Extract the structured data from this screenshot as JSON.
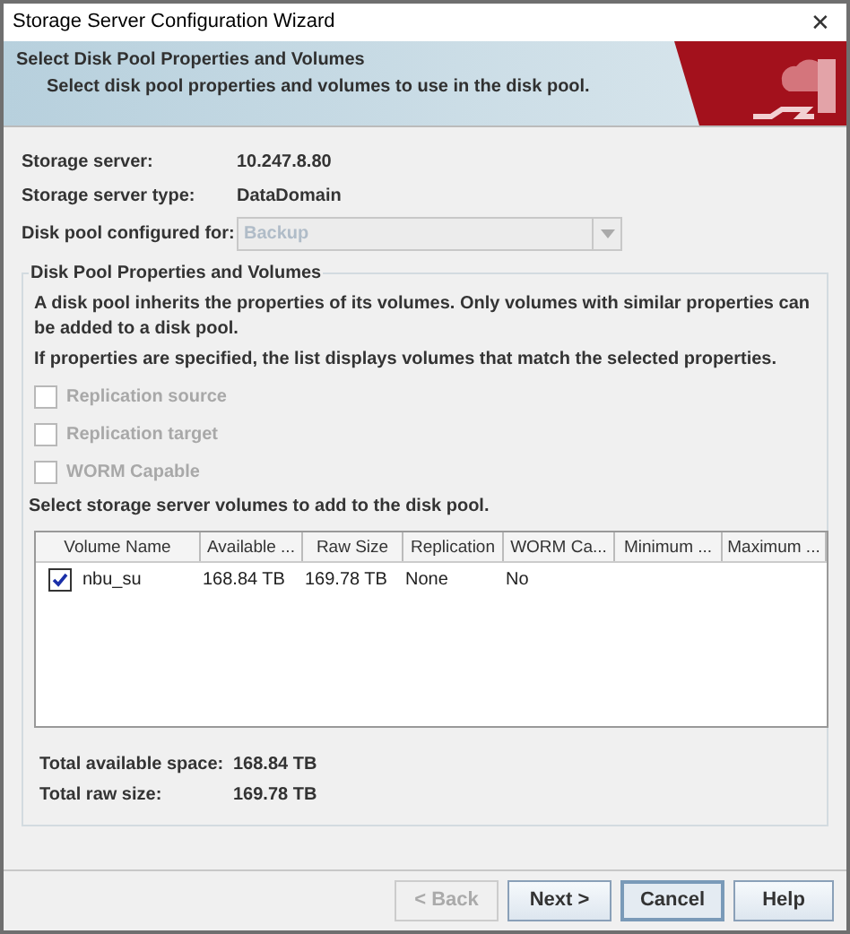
{
  "window": {
    "title": "Storage Server Configuration Wizard",
    "close": "✕"
  },
  "header": {
    "title": "Select Disk Pool Properties and Volumes",
    "subtitle": "Select disk pool properties and volumes to use in the disk pool."
  },
  "info": [
    {
      "label": "Storage server:",
      "value": "10.247.8.80"
    },
    {
      "label": "Storage server type:",
      "value": "DataDomain"
    }
  ],
  "pool": {
    "label": "Disk pool configured for:",
    "value": "Backup",
    "disabled": true
  },
  "group": {
    "title": "Disk Pool Properties and Volumes",
    "paragraphs": [
      "A disk pool inherits the properties of its volumes. Only volumes with similar properties can be added to a disk pool.",
      "If properties are specified, the list displays volumes that match the selected properties."
    ],
    "options": [
      {
        "label": "Replication source",
        "checked": false,
        "disabled": true
      },
      {
        "label": "Replication target",
        "checked": false,
        "disabled": true
      },
      {
        "label": "WORM Capable",
        "checked": false,
        "disabled": true
      }
    ],
    "table_caption": "Select storage server volumes to add to the disk pool.",
    "table": {
      "columns": [
        "Volume Name",
        "Available ...",
        "Raw Size",
        "Replication",
        "WORM Ca...",
        "Minimum ...",
        "Maximum ..."
      ],
      "rows": [
        {
          "checked": true,
          "cells": [
            "nbu_su",
            "168.84 TB",
            "169.78 TB",
            "None",
            "No"
          ]
        }
      ]
    },
    "totals": [
      {
        "label": "Total available space:",
        "value": "168.84 TB"
      },
      {
        "label": "Total raw size:",
        "value": "169.78 TB"
      }
    ]
  },
  "buttons": [
    {
      "label": "< Back",
      "disabled": true,
      "focused": false
    },
    {
      "label": "Next >",
      "disabled": false,
      "focused": false
    },
    {
      "label": "Cancel",
      "disabled": false,
      "focused": true
    },
    {
      "label": "Help",
      "disabled": false,
      "focused": false
    }
  ]
}
